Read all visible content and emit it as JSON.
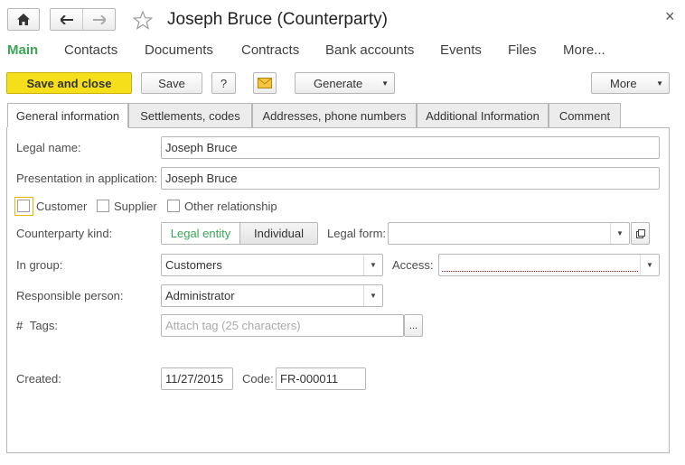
{
  "window": {
    "title": "Joseph Bruce (Counterparty)",
    "close_glyph": "×"
  },
  "nav": {
    "items": [
      {
        "label": "Main"
      },
      {
        "label": "Contacts"
      },
      {
        "label": "Documents"
      },
      {
        "label": "Contracts"
      },
      {
        "label": "Bank accounts"
      },
      {
        "label": "Events"
      },
      {
        "label": "Files"
      },
      {
        "label": "More..."
      }
    ]
  },
  "toolbar": {
    "save_close_label": "Save and close",
    "save_label": "Save",
    "help_label": "?",
    "generate_label": "Generate",
    "more_label": "More"
  },
  "tabs": [
    {
      "label": "General information"
    },
    {
      "label": "Settlements, codes"
    },
    {
      "label": "Addresses, phone numbers"
    },
    {
      "label": "Additional Information"
    },
    {
      "label": "Comment"
    }
  ],
  "form": {
    "legal_name_label": "Legal name:",
    "legal_name_value": "Joseph Bruce",
    "presentation_label": "Presentation in application:",
    "presentation_value": "Joseph Bruce",
    "customer_label": "Customer",
    "supplier_label": "Supplier",
    "other_label": "Other relationship",
    "kind_label": "Counterparty kind:",
    "kind_legal": "Legal entity",
    "kind_individual": "Individual",
    "legal_form_label": "Legal form:",
    "legal_form_value": "",
    "group_label": "In group:",
    "group_value": "Customers",
    "access_label": "Access:",
    "access_value": "",
    "responsible_label": "Responsible person:",
    "responsible_value": "Administrator",
    "tags_label": "Tags:",
    "tags_prefix": "#",
    "tags_placeholder": "Attach tag (25 characters)",
    "tags_btn": "...",
    "created_label": "Created:",
    "created_value": "11/27/2015",
    "code_label": "Code:",
    "code_value": "FR-000011"
  },
  "colors": {
    "accent_green": "#3aa655",
    "primary_button": "#f5de1a"
  }
}
